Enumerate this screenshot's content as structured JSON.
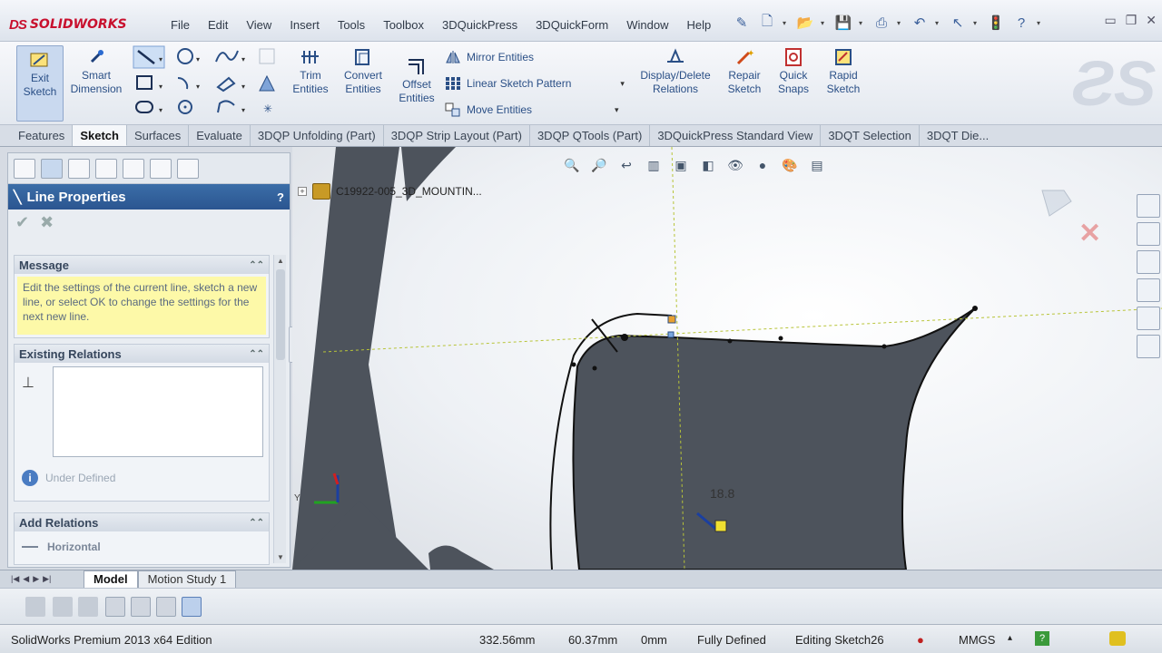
{
  "app": {
    "brand": "SOLIDWORKS",
    "brand_prefix": "DS"
  },
  "menu": [
    "File",
    "Edit",
    "View",
    "Insert",
    "Tools",
    "Toolbox",
    "3DQuickPress",
    "3DQuickForm",
    "Window",
    "Help"
  ],
  "ribbon": {
    "exit_sketch": "Exit Sketch",
    "smart_dimension": "Smart Dimension",
    "trim_entities": "Trim Entities",
    "convert_entities": "Convert Entities",
    "offset_entities": "Offset Entities",
    "mirror_entities": "Mirror Entities",
    "linear_sketch_pattern": "Linear Sketch Pattern",
    "move_entities": "Move Entities",
    "display_delete_relations": "Display/Delete Relations",
    "repair_sketch": "Repair Sketch",
    "quick_snaps": "Quick Snaps",
    "rapid_sketch": "Rapid Sketch"
  },
  "cm_tabs": [
    "Features",
    "Sketch",
    "Surfaces",
    "Evaluate",
    "3DQP Unfolding (Part)",
    "3DQP Strip Layout (Part)",
    "3DQP QTools (Part)",
    "3DQuickPress Standard View",
    "3DQT Selection",
    "3DQT Die..."
  ],
  "cm_active": "Sketch",
  "property_manager": {
    "title": "Line Properties",
    "help": "?",
    "ok_icon": "✔",
    "cancel_icon": "✖",
    "message_header": "Message",
    "message_text": "Edit the settings of the current line, sketch a new line, or select OK to change the settings for the next new line.",
    "existing_relations_header": "Existing Relations",
    "relation_glyph": "⊥",
    "status_text": "Under Defined",
    "info_glyph": "i",
    "add_relations_header": "Add Relations",
    "add_relation_item": "Horizontal"
  },
  "graphics": {
    "tree_item": "C19922-005_3D_MOUNTIN...",
    "dimension_value": "18.8",
    "triad_y": "Y",
    "confirm_x": "✕"
  },
  "bottom_tabs": [
    "Model",
    "Motion Study 1"
  ],
  "bottom_active": "Model",
  "status": {
    "edition": "SolidWorks Premium 2013 x64 Edition",
    "x": "332.56mm",
    "y": "60.37mm",
    "z": "0mm",
    "state": "Fully Defined",
    "editing": "Editing Sketch26",
    "units": "MMGS",
    "units_caret": "▴",
    "help_glyph": "?"
  },
  "colors": {
    "body": "#4d535c",
    "sketch_line": "#111111",
    "accent_blue": "#2b5590",
    "message_bg": "#fdf9a8"
  }
}
